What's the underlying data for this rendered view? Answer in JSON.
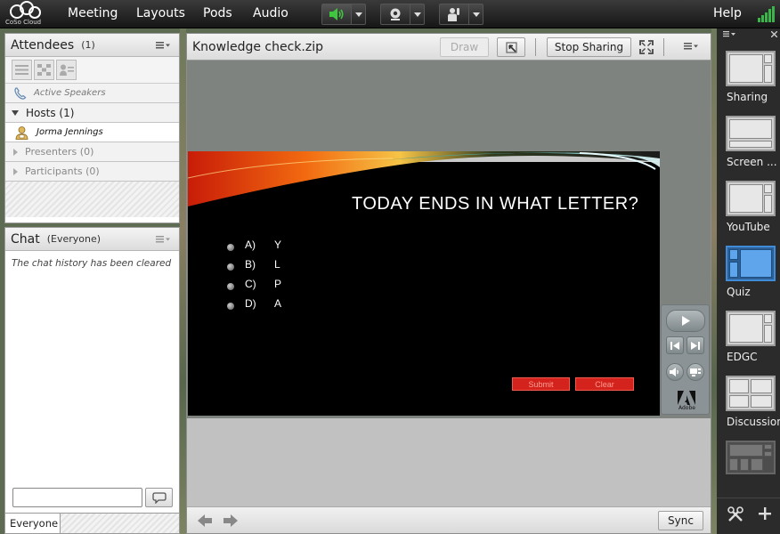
{
  "app": {
    "logo_text": "CoSo Cloud",
    "menu": [
      "Meeting",
      "Layouts",
      "Pods",
      "Audio"
    ],
    "help_label": "Help"
  },
  "attendees": {
    "title": "Attendees",
    "count": "(1)",
    "active_speakers": "Active Speakers",
    "hosts_label": "Hosts (1)",
    "host_name": "Jorma Jennings",
    "presenters_label": "Presenters (0)",
    "participants_label": "Participants (0)"
  },
  "chat": {
    "title": "Chat",
    "scope": "(Everyone)",
    "message": "The chat history has been cleared",
    "input_value": "",
    "recipient_tab": "Everyone"
  },
  "share": {
    "title": "Knowledge check.zip",
    "draw_label": "Draw",
    "stop_sharing_label": "Stop Sharing",
    "sync_label": "Sync"
  },
  "slide": {
    "question": "TODAY ENDS IN WHAT LETTER?",
    "options": [
      {
        "letter": "A)",
        "text": "Y"
      },
      {
        "letter": "B)",
        "text": "L"
      },
      {
        "letter": "C)",
        "text": "P"
      },
      {
        "letter": "D)",
        "text": "A"
      }
    ],
    "submit_label": "Submit",
    "clear_label": "Clear",
    "adobe_label": "Adobe"
  },
  "layouts": {
    "items": [
      {
        "label": "Sharing"
      },
      {
        "label": "Screen ..."
      },
      {
        "label": "YouTube"
      },
      {
        "label": "Quiz",
        "selected": true
      },
      {
        "label": "EDGC"
      },
      {
        "label": "Discussion"
      }
    ]
  },
  "colors": {
    "accent_selected": "#3f8bd8",
    "audio_active": "#3ec63e",
    "quiz_button": "#d4231d",
    "signal_bars": "#39b54a"
  }
}
